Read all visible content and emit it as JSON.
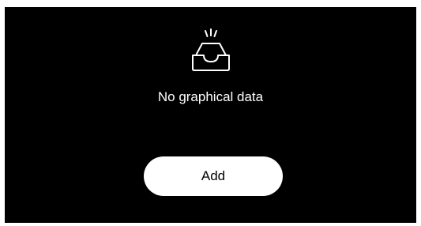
{
  "empty_state": {
    "icon": "empty-inbox-tray-icon",
    "message": "No graphical data",
    "add_label": "Add"
  },
  "colors": {
    "panel_background": "#000000",
    "text": "#ffffff",
    "button_background": "#ffffff",
    "button_text": "#000000"
  }
}
